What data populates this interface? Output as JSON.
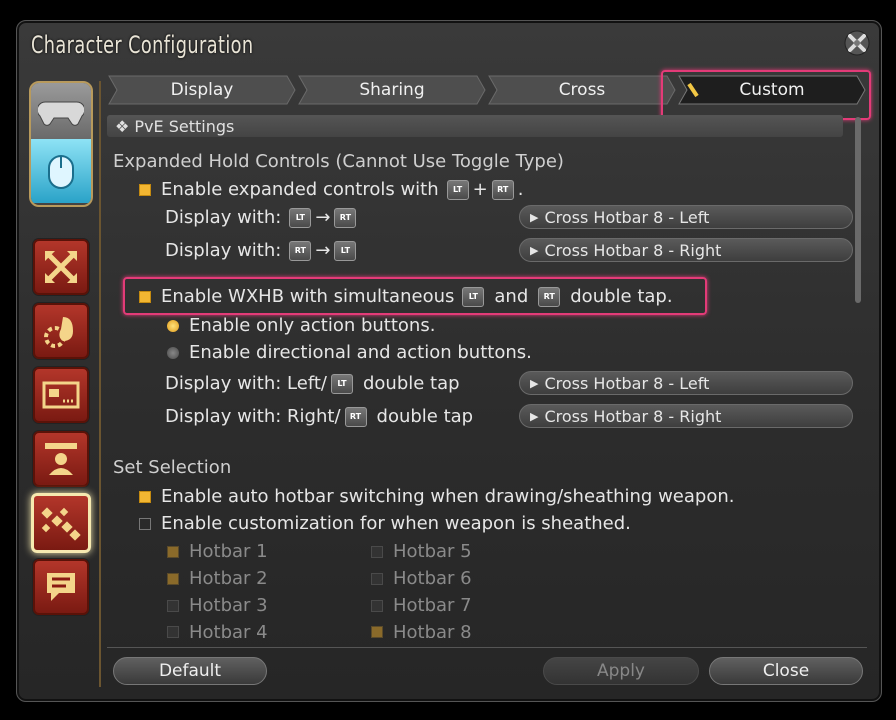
{
  "window": {
    "title": "Character Configuration"
  },
  "tabs": [
    {
      "label": "Display"
    },
    {
      "label": "Sharing"
    },
    {
      "label": "Cross"
    },
    {
      "label": "Custom"
    }
  ],
  "section": {
    "title": "❖ PvE Settings"
  },
  "expanded": {
    "header": "Expanded Hold Controls (Cannot Use Toggle Type)",
    "enable_prefix": "Enable expanded controls with",
    "plus": "+",
    "period": ".",
    "display_with": "Display with:",
    "arrow": "→",
    "dropdown1": "Cross Hotbar 8 - Left",
    "dropdown2": "Cross Hotbar 8 - Right"
  },
  "wxhb": {
    "prefix": "Enable WXHB with simultaneous",
    "and": "and",
    "suffix": "double tap.",
    "radio1": "Enable only action buttons.",
    "radio2": "Enable directional and action buttons.",
    "left_prefix": "Display with: Left/",
    "right_prefix": "Display with: Right/",
    "double_tap": "double tap",
    "dropdown_left": "Cross Hotbar 8 - Left",
    "dropdown_right": "Cross Hotbar 8 - Right"
  },
  "keys": {
    "lt": "LT",
    "rt": "RT"
  },
  "set_selection": {
    "header": "Set Selection",
    "auto_switch": "Enable auto hotbar switching when drawing/sheathing weapon.",
    "customize": "Enable customization for when weapon is sheathed.",
    "hotbars_left": [
      "Hotbar 1",
      "Hotbar 2",
      "Hotbar 3",
      "Hotbar 4"
    ],
    "hotbars_right": [
      "Hotbar 5",
      "Hotbar 6",
      "Hotbar 7",
      "Hotbar 8"
    ]
  },
  "buttons": {
    "default": "Default",
    "apply": "Apply",
    "close": "Close"
  },
  "icons": [
    "close-icon",
    "gamepad-icon",
    "mouse-icon",
    "move-arrows-icon",
    "gear-bag-icon",
    "id-card-icon",
    "character-icon",
    "hotbar-icon",
    "chat-icon"
  ],
  "colors": {
    "accent": "#e33b78",
    "checkbox_on": "#f2b632",
    "sidebar_red": "#b3362a"
  }
}
